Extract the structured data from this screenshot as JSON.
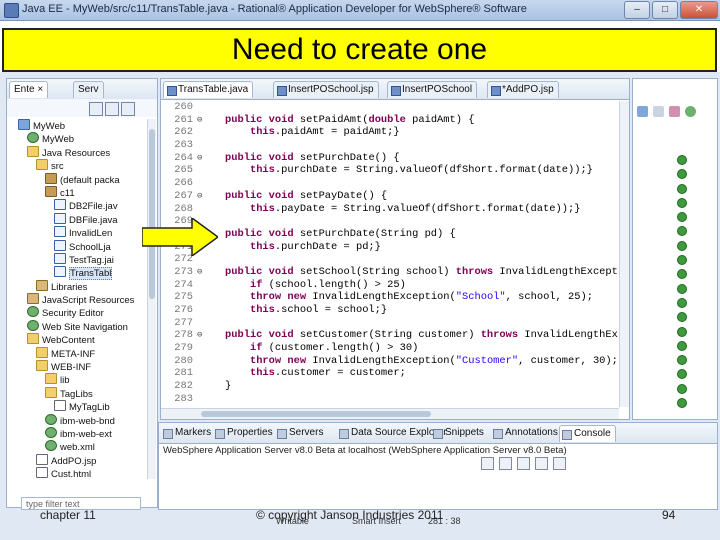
{
  "window": {
    "title": "Java EE - MyWeb/src/c11/TransTable.java - Rational® Application Developer for WebSphere® Software",
    "controls": [
      "minimize",
      "maximize",
      "close"
    ]
  },
  "slide": {
    "heading": "Need to create one",
    "footer_left": "chapter 11",
    "footer_center": "© copyright Janson Industries 2011",
    "page_number": "94",
    "arrow_color": "#ffff00"
  },
  "left_view": {
    "tabs": [
      "Ente",
      "Serv"
    ],
    "tree": [
      {
        "label": "MyWeb",
        "icon": "project",
        "indent": 1
      },
      {
        "label": "MyWeb",
        "icon": "globe",
        "indent": 2
      },
      {
        "label": "Java Resources",
        "icon": "folder",
        "indent": 2
      },
      {
        "label": "src",
        "icon": "folder",
        "indent": 3
      },
      {
        "label": "(default packa",
        "icon": "package",
        "indent": 4
      },
      {
        "label": "c11",
        "icon": "package",
        "indent": 4
      },
      {
        "label": "DB2File.jav",
        "icon": "java",
        "indent": 5
      },
      {
        "label": "DBFile.java",
        "icon": "java",
        "indent": 5
      },
      {
        "label": "InvalidLen",
        "icon": "java",
        "indent": 5
      },
      {
        "label": "SchoolLja",
        "icon": "java",
        "indent": 5
      },
      {
        "label": "TestTag.jai",
        "icon": "java",
        "indent": 5
      },
      {
        "label": "TransTabl",
        "icon": "java",
        "indent": 5,
        "selected": true
      },
      {
        "label": "Libraries",
        "icon": "lib",
        "indent": 3
      },
      {
        "label": "JavaScript Resources",
        "icon": "lib",
        "indent": 2
      },
      {
        "label": "Security Editor",
        "icon": "globe",
        "indent": 2
      },
      {
        "label": "Web Site Navigation",
        "icon": "globe",
        "indent": 2
      },
      {
        "label": "WebContent",
        "icon": "folder",
        "indent": 2
      },
      {
        "label": "META-INF",
        "icon": "folder",
        "indent": 3
      },
      {
        "label": "WEB-INF",
        "icon": "folder",
        "indent": 3
      },
      {
        "label": "lib",
        "icon": "folder",
        "indent": 4
      },
      {
        "label": "TagLibs",
        "icon": "folder",
        "indent": 4
      },
      {
        "label": "MyTagLib",
        "icon": "file",
        "indent": 5
      },
      {
        "label": "ibm-web-bnd",
        "icon": "globe",
        "indent": 4
      },
      {
        "label": "ibm-web-ext",
        "icon": "globe",
        "indent": 4
      },
      {
        "label": "web.xml",
        "icon": "globe",
        "indent": 4
      },
      {
        "label": "AddPO.jsp",
        "icon": "file",
        "indent": 3
      },
      {
        "label": "Cust.html",
        "icon": "file",
        "indent": 3
      }
    ],
    "filter_placeholder": "type filter text"
  },
  "editor": {
    "tabs": [
      "TransTable.java",
      "InsertPOSchool.jsp",
      "InsertPOSchool",
      "*AddPO.jsp"
    ],
    "active_tab": 0,
    "lines": [
      {
        "n": "260",
        "text": ""
      },
      {
        "n": "261",
        "fold": true,
        "text": "public void setPaidAmt(double paidAmt) {"
      },
      {
        "n": "262",
        "text": "    this.paidAmt = paidAmt;}"
      },
      {
        "n": "263",
        "text": ""
      },
      {
        "n": "264",
        "fold": true,
        "text": "public void setPurchDate() {"
      },
      {
        "n": "265",
        "text": "    this.purchDate = String.valueOf(dfShort.format(date));}"
      },
      {
        "n": "266",
        "text": ""
      },
      {
        "n": "267",
        "fold": true,
        "text": "public void setPayDate() {"
      },
      {
        "n": "268",
        "text": "    this.payDate = String.valueOf(dfShort.format(date));}"
      },
      {
        "n": "269",
        "text": ""
      },
      {
        "n": "270",
        "fold": true,
        "text": "public void setPurchDate(String pd) {"
      },
      {
        "n": "271",
        "text": "    this.purchDate = pd;}"
      },
      {
        "n": "272",
        "text": ""
      },
      {
        "n": "273",
        "fold": true,
        "text": "public void setSchool(String school) throws InvalidLengthExcept"
      },
      {
        "n": "274",
        "text": "    if (school.length() > 25)"
      },
      {
        "n": "275",
        "text": "    throw new InvalidLengthException(\"School\", school, 25);"
      },
      {
        "n": "276",
        "text": "    this.school = school;}"
      },
      {
        "n": "277",
        "text": ""
      },
      {
        "n": "278",
        "fold": true,
        "text": "public void setCustomer(String customer) throws InvalidLengthEx"
      },
      {
        "n": "279",
        "text": "    if (customer.length() > 30)"
      },
      {
        "n": "280",
        "text": "    throw new InvalidLengthException(\"Customer\", customer, 30);"
      },
      {
        "n": "281",
        "text": "    this.customer = customer;"
      },
      {
        "n": "282",
        "text": "}"
      },
      {
        "n": "283",
        "text": ""
      }
    ]
  },
  "console": {
    "tabs": [
      "Markers",
      "Properties",
      "Servers",
      "Data Source Explorer",
      "Snippets",
      "Annotations",
      "Console"
    ],
    "active_tab": 6,
    "server_line": "WebSphere Application Server v8.0 Beta at localhost (WebSphere Application Server v8.0 Beta)"
  },
  "status_bar": {
    "writable": "Writable",
    "insert_mode": "Smart Insert",
    "position": "281 : 38"
  }
}
